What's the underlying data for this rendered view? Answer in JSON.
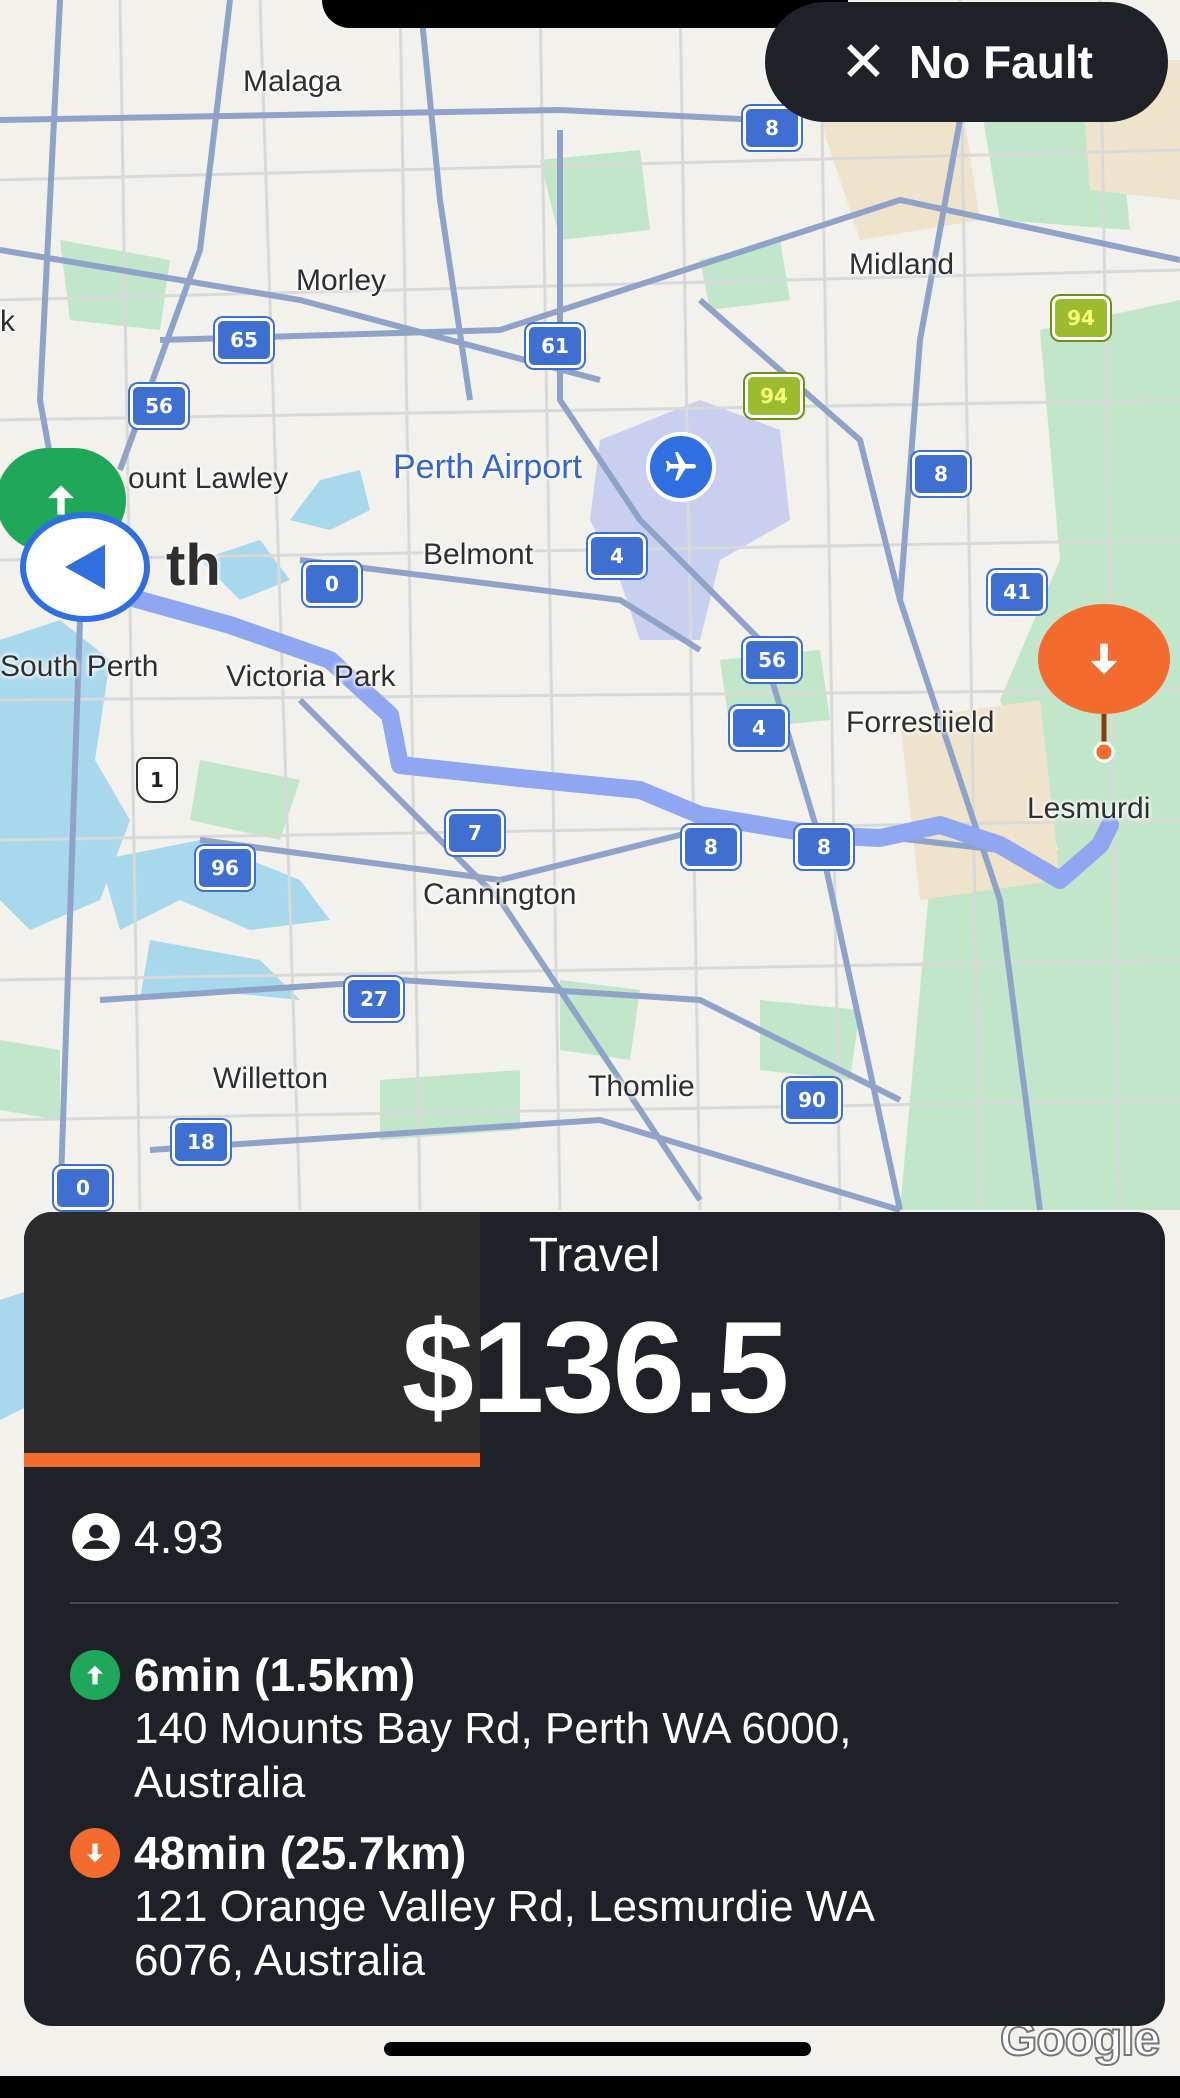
{
  "map": {
    "places": [
      "Malaga",
      "Morley",
      "Midland",
      "Mount Lawley",
      "Perth Airport",
      "Perth",
      "Belmont",
      "South Perth",
      "Victoria Park",
      "Forrestfield",
      "Lesmurdie",
      "Cannington",
      "Willetton",
      "Thomlie"
    ],
    "place_labels": {
      "malaga": "Malaga",
      "morley": "Morley",
      "midland": "Midland",
      "mount_lawley": "ount Lawley",
      "perth_airport": "Perth Airport",
      "perth": "th",
      "belmont": "Belmont",
      "south_perth": "South Perth",
      "victoria_park": "Victoria Park",
      "forrestfield": "Forrestiield",
      "lesmurdie": "Lesmurdi",
      "cannington": "Cannington",
      "willetton": "Willetton",
      "thomlie": "Thomlie",
      "edge_left": "k"
    },
    "route_shields": [
      "8",
      "65",
      "61",
      "94",
      "94",
      "56",
      "8",
      "41",
      "4",
      "56",
      "4",
      "8",
      "8",
      "7",
      "1",
      "96",
      "27",
      "90",
      "18",
      "0",
      "0"
    ],
    "accent_colors": {
      "route": "#8fa6f0",
      "water": "#a8d8ec",
      "park": "#bde5c5",
      "pickup": "#1fa85a",
      "dropoff": "#f36b2d",
      "current_location": "#2f6fe0"
    },
    "attribution": "Google"
  },
  "header": {
    "dismiss": {
      "label": "No Fault",
      "icon": "close-icon"
    }
  },
  "card": {
    "title": "Travel",
    "price": "$136.5",
    "timer_progress_fraction": 0.4,
    "rating": {
      "icon": "rider-profile-icon",
      "value": "4.93"
    },
    "pickup": {
      "icon": "pickup-arrow-up-icon",
      "eta": "6min (1.5km)",
      "address_line1": "140 Mounts Bay Rd, Perth WA 6000,",
      "address_line2": "Australia"
    },
    "dropoff": {
      "icon": "dropoff-arrow-down-icon",
      "eta": "48min (25.7km)",
      "address_line1": "121 Orange Valley Rd, Lesmurdie WA",
      "address_line2": "6076, Australia"
    }
  }
}
